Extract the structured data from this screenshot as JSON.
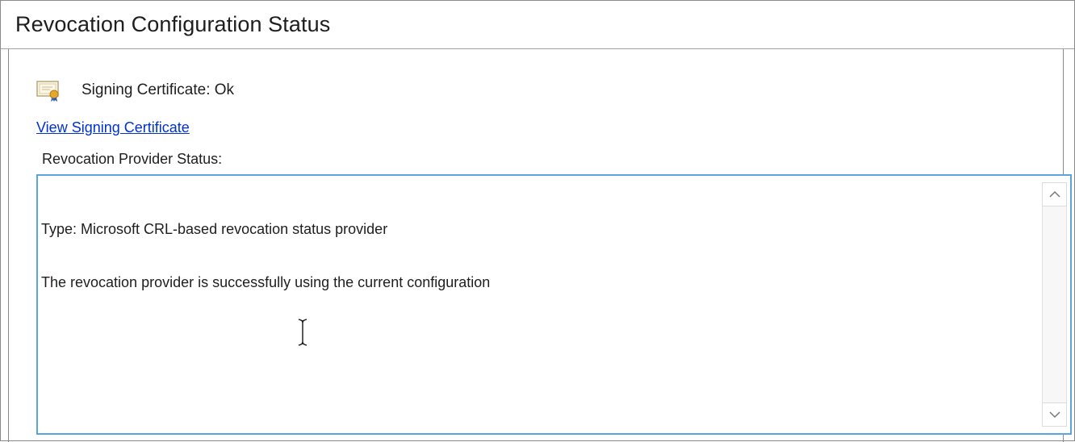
{
  "header": {
    "title": "Revocation Configuration Status"
  },
  "signing": {
    "icon": "certificate-icon",
    "status_text": "Signing Certificate: Ok",
    "view_link": "View Signing Certificate"
  },
  "provider": {
    "label": "Revocation Provider Status:",
    "lines": [
      "Type: Microsoft CRL-based revocation status provider",
      "The revocation provider is successfully using the current configuration"
    ]
  },
  "scrollbar": {
    "up_icon": "chevron-up-icon",
    "down_icon": "chevron-down-icon"
  },
  "colors": {
    "link": "#0033cc",
    "textbox_border": "#5aa6dc"
  }
}
